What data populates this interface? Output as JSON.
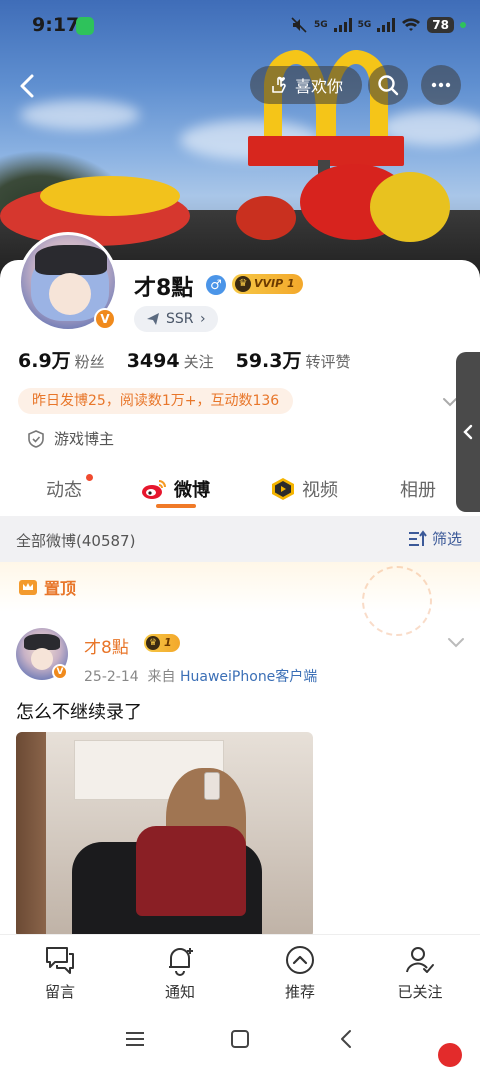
{
  "status_bar": {
    "time": "9:17",
    "battery": "78",
    "signal_labels": [
      "5G",
      "5G"
    ]
  },
  "top_nav": {
    "like_label": "喜欢你"
  },
  "profile": {
    "username": "才8點",
    "gender_symbol": "♂",
    "vip_label": "VVIP 1",
    "verified_badge": "V",
    "ssr_label": "SSR",
    "stats": [
      {
        "value": "6.9万",
        "label": "粉丝"
      },
      {
        "value": "3494",
        "label": "关注"
      },
      {
        "value": "59.3万",
        "label": "转评赞"
      }
    ],
    "activity_summary": "昨日发博25，阅读数1万+，互动数136",
    "tag_label": "游戏博主"
  },
  "tabs": [
    {
      "label": "动态",
      "active": false,
      "has_dot": true
    },
    {
      "label": "微博",
      "active": true,
      "has_dot": false
    },
    {
      "label": "视频",
      "active": false,
      "has_dot": false
    },
    {
      "label": "相册",
      "active": false,
      "has_dot": false
    }
  ],
  "feed": {
    "section_title": "全部微博(40587)",
    "filter_label": "筛选",
    "pinned_label": "置顶"
  },
  "post": {
    "author": "才8點",
    "vip_level": "1",
    "date": "25-2-14",
    "source_prefix": "来自",
    "source": "HuaweiPhone客户端",
    "text": "怎么不继续录了"
  },
  "bottom_bar": [
    {
      "label": "留言",
      "icon": "message-icon"
    },
    {
      "label": "通知",
      "icon": "bell-plus-icon"
    },
    {
      "label": "推荐",
      "icon": "chevron-up-circle-icon"
    },
    {
      "label": "已关注",
      "icon": "user-check-icon"
    }
  ],
  "colors": {
    "accent_orange": "#e8762a",
    "link_blue": "#3b6fb6",
    "vip_gold": "#f6c846"
  }
}
